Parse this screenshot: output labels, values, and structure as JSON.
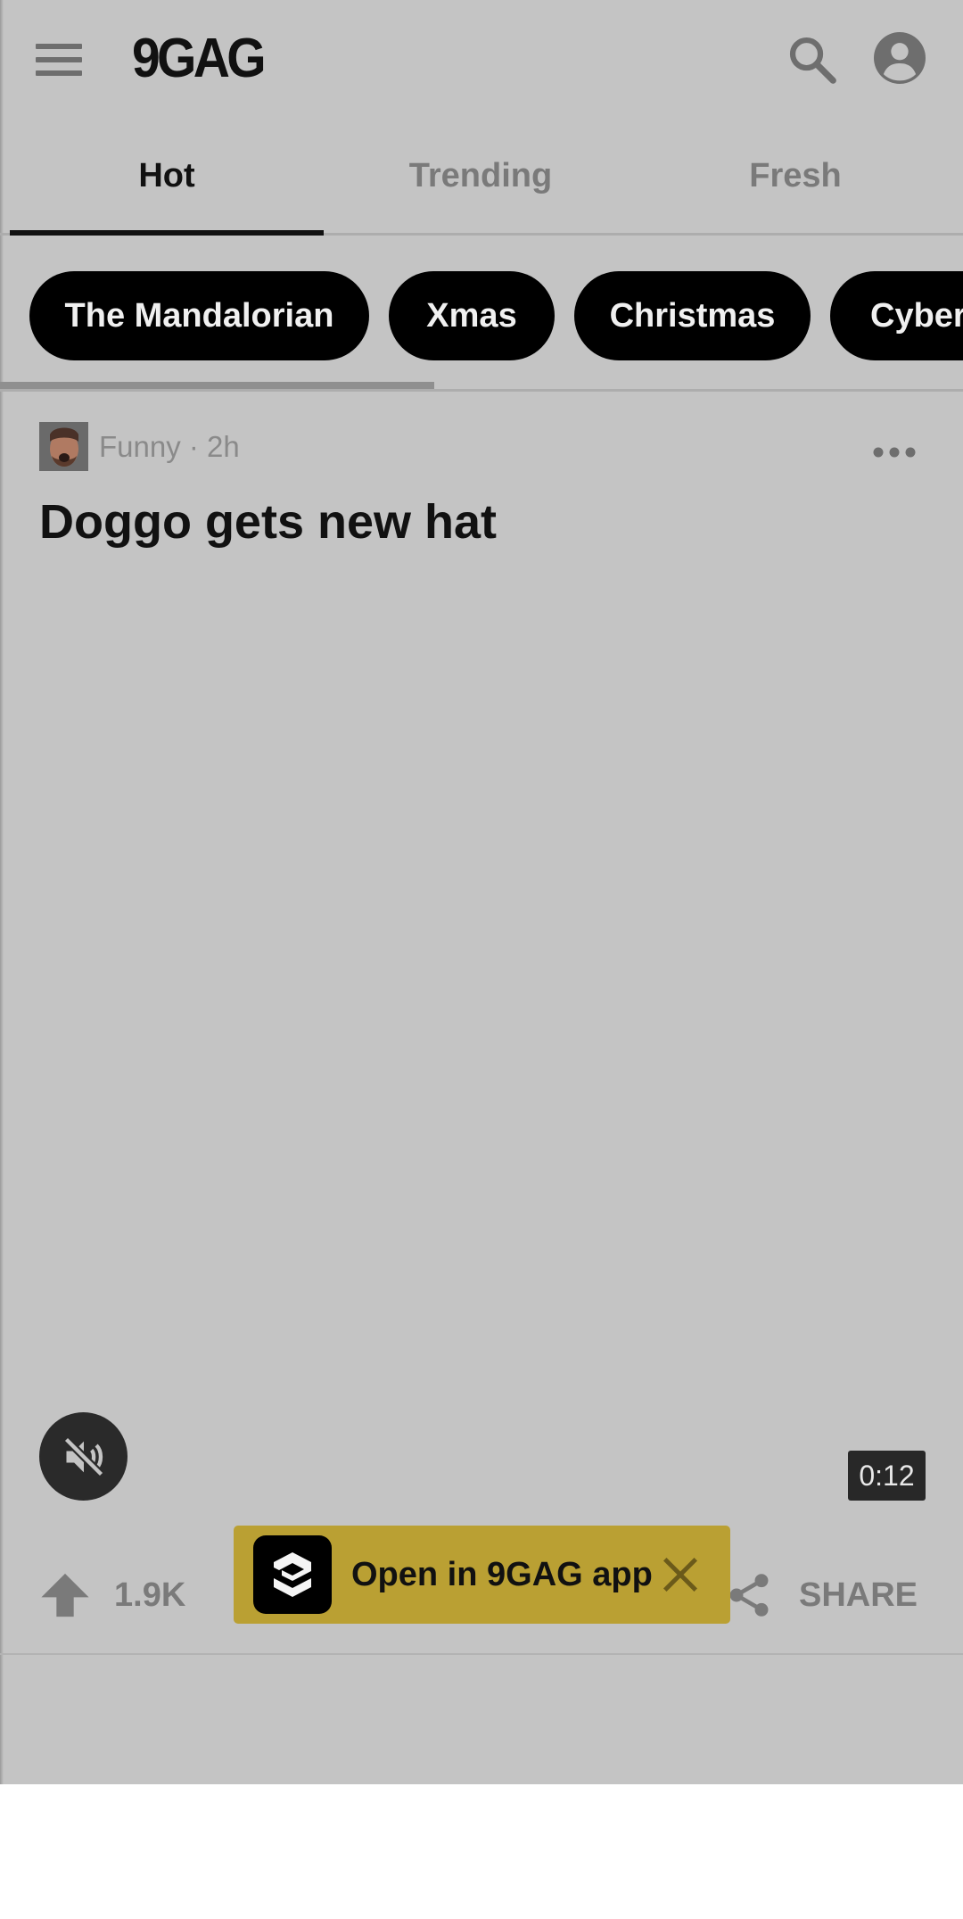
{
  "header": {
    "logo_text": "9GAG",
    "menu_icon": "hamburger-menu-icon",
    "search_icon": "search-icon",
    "account_icon": "account-circle-icon"
  },
  "tabs": [
    {
      "label": "Hot",
      "active": true
    },
    {
      "label": "Trending",
      "active": false
    },
    {
      "label": "Fresh",
      "active": false
    }
  ],
  "chips": [
    {
      "label": "The Mandalorian"
    },
    {
      "label": "Xmas"
    },
    {
      "label": "Christmas"
    },
    {
      "label": "Cyberp"
    }
  ],
  "post": {
    "section": "Funny",
    "time": "2h",
    "meta_text": "Funny · 2h",
    "title": "Doggo gets new hat",
    "duration": "0:12",
    "mute_icon": "volume-off-icon",
    "more_icon": "more-horizontal-icon"
  },
  "actions": {
    "upvote_icon": "arrow-up-icon",
    "vote_count": "1.9K",
    "share_icon": "share-icon",
    "share_label": "SHARE"
  },
  "app_banner": {
    "text": "Open in 9GAG app",
    "close_icon": "close-icon"
  },
  "colors": {
    "overlay_bg": "#c4c4c4",
    "chip_bg": "#000000",
    "banner_bg": "#baa033",
    "active_text": "#111111",
    "inactive_text": "#7a7a7a"
  }
}
